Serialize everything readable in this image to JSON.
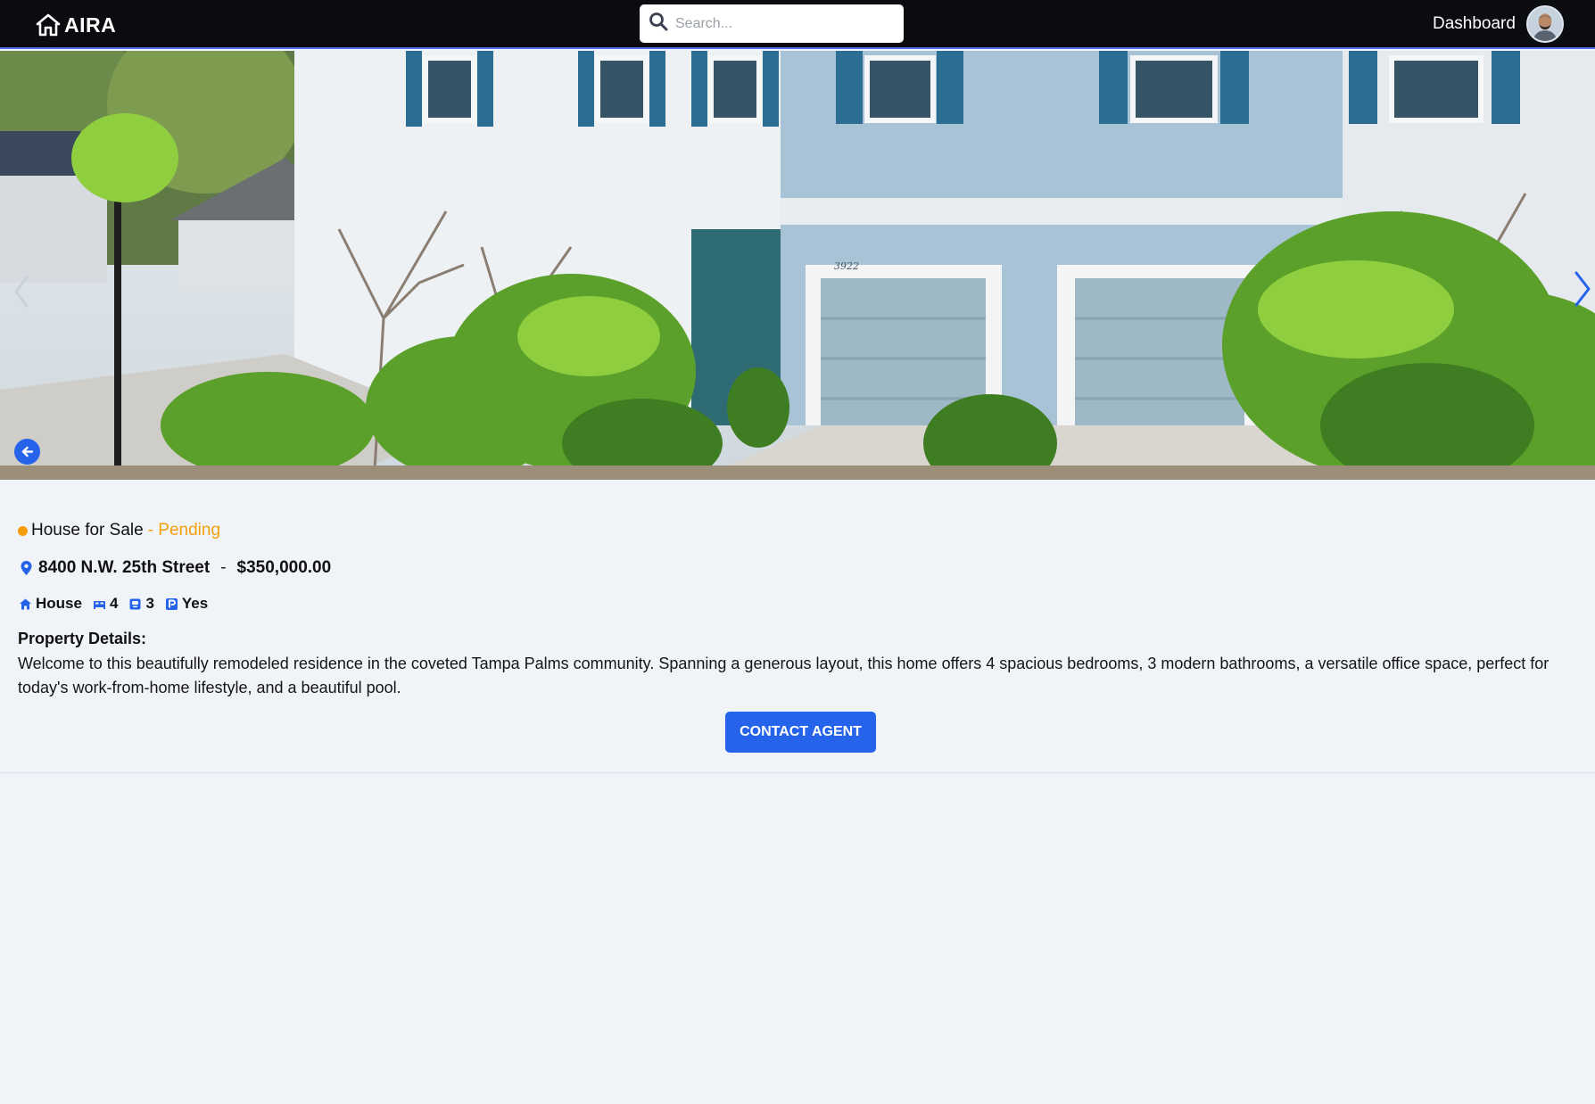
{
  "app": {
    "brand": "AIRA",
    "search_placeholder": "Search...",
    "nav_link": "Dashboard"
  },
  "listing": {
    "type_label": "House for Sale",
    "status": "- Pending",
    "status_color": "#f59e0b",
    "address": "8400 N.W. 25th Street",
    "separator": "-",
    "price": "$350,000.00",
    "features": {
      "property_type": "House",
      "bedrooms": "4",
      "bathrooms": "3",
      "parking": "Yes"
    },
    "details_heading": "Property Details:",
    "details_text": "Welcome to this beautifully remodeled residence in the coveted Tampa Palms community. Spanning a generous layout, this home offers 4 spacious bedrooms, 3 modern bathrooms, a versatile office space, perfect for today's work-from-home lifestyle, and a beautiful pool.",
    "contact_label": "CONTACT AGENT",
    "house_number_sign": "3922"
  },
  "colors": {
    "accent": "#2563eb",
    "nav_bg": "#0b0c10",
    "page_bg": "#f0f3f8",
    "pending": "#f59e0b"
  },
  "icons": {
    "brand": "home-icon",
    "search": "search-icon",
    "address": "map-pin-icon",
    "property_type": "home-icon",
    "bedrooms": "bed-icon",
    "bathrooms": "bath-icon",
    "parking": "parking-icon",
    "back": "arrow-left-icon",
    "carousel_prev": "chevron-left-icon",
    "carousel_next": "chevron-right-icon"
  }
}
